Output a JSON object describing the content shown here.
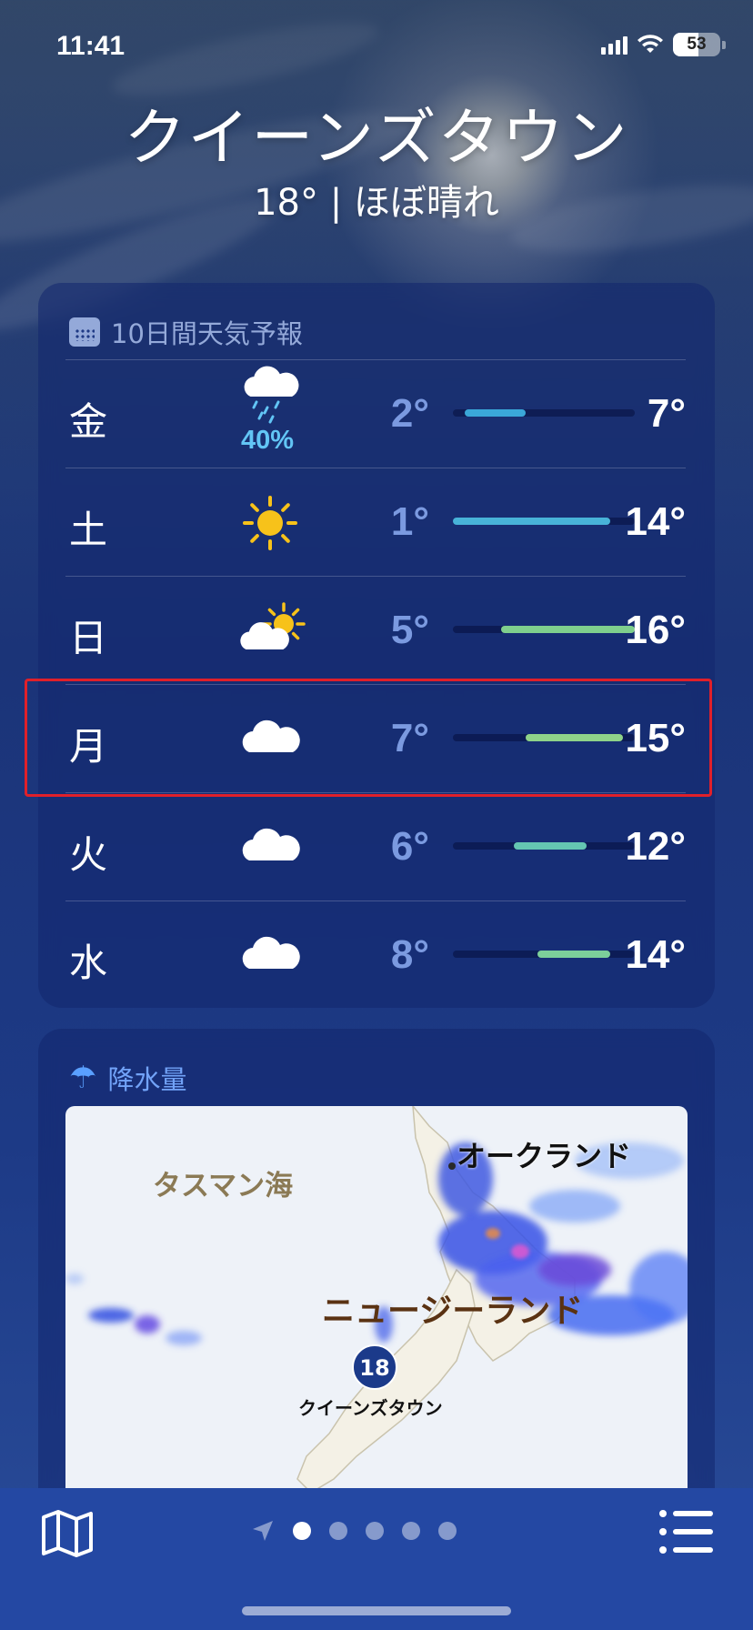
{
  "status_bar": {
    "time": "11:41",
    "battery": "53",
    "battery_level": 0.53
  },
  "header": {
    "city": "クイーンズタウン",
    "current": "18° | ほぼ晴れ"
  },
  "forecast": {
    "title": "10日間天気予報",
    "days": [
      {
        "day": "金",
        "icon": "cloud-rain-icon",
        "pop": "40%",
        "low": "2°",
        "high": "7°",
        "range": [
          2,
          7
        ],
        "color": "#3aa7d8"
      },
      {
        "day": "土",
        "icon": "sun-icon",
        "pop": "",
        "low": "1°",
        "high": "14°",
        "range": [
          1,
          14
        ],
        "color": "#48b3d8"
      },
      {
        "day": "日",
        "icon": "partly-sunny-icon",
        "pop": "",
        "low": "5°",
        "high": "16°",
        "range": [
          5,
          16
        ],
        "color": "#7fcf8d"
      },
      {
        "day": "月",
        "icon": "cloud-icon",
        "pop": "",
        "low": "7°",
        "high": "15°",
        "range": [
          7,
          15
        ],
        "color": "#8fd389"
      },
      {
        "day": "火",
        "icon": "cloud-icon",
        "pop": "",
        "low": "6°",
        "high": "12°",
        "range": [
          6,
          12
        ],
        "color": "#64c6b2"
      },
      {
        "day": "水",
        "icon": "cloud-icon",
        "pop": "",
        "low": "8°",
        "high": "14°",
        "range": [
          8,
          14
        ],
        "color": "#7ccf9a"
      }
    ],
    "scale": [
      1,
      16
    ]
  },
  "precip": {
    "title": "降水量",
    "map": {
      "sea_label": "タスマン海",
      "country_label": "ニュージーランド",
      "city_label": "オークランド",
      "pin_temp": "18",
      "pin_label": "クイーンズタウン"
    }
  },
  "bottom_bar": {
    "pages": 6,
    "active_page": 1
  }
}
